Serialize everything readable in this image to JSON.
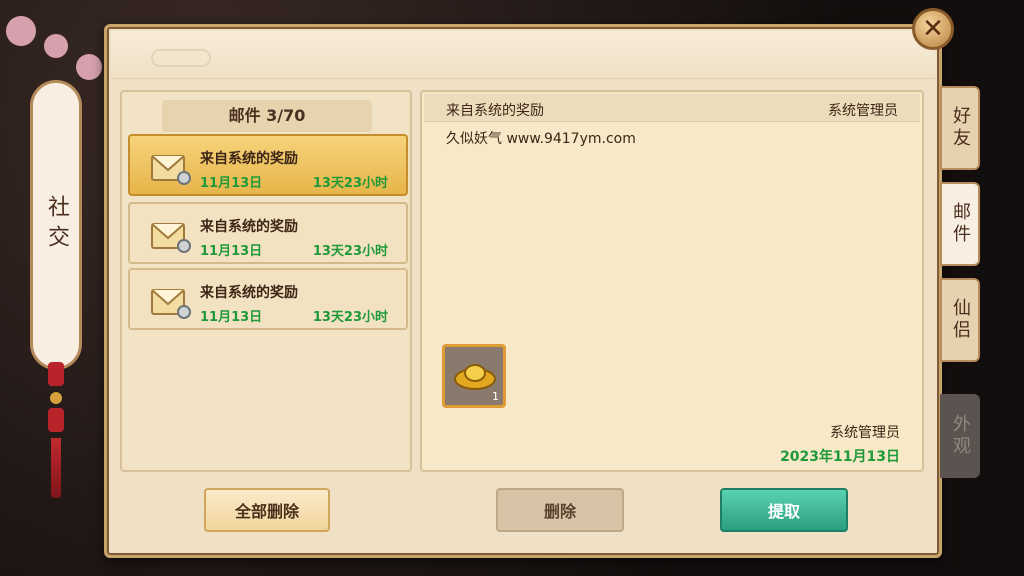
{
  "left_banner": {
    "label": "社交"
  },
  "mail_list": {
    "header": "邮件 3/70",
    "items": [
      {
        "title": "来自系统的奖励",
        "date": "11月13日",
        "expire": "13天23小时"
      },
      {
        "title": "来自系统的奖励",
        "date": "11月13日",
        "expire": "13天23小时"
      },
      {
        "title": "来自系统的奖励",
        "date": "11月13日",
        "expire": "13天23小时"
      }
    ]
  },
  "detail": {
    "subject": "来自系统的奖励",
    "sender_top": "系统管理员",
    "body": "久似妖气 www.9417ym.com",
    "attachment": {
      "icon": "gold-ingot-icon",
      "count": "1"
    },
    "sender_bottom": "系统管理员",
    "date": "2023年11月13日"
  },
  "buttons": {
    "delete_all": "全部删除",
    "delete": "删除",
    "claim": "提取"
  },
  "side_tabs": [
    {
      "label": "好友"
    },
    {
      "label": "邮件"
    },
    {
      "label": "仙侣"
    },
    {
      "label": "外观"
    }
  ],
  "close_glyph": "✕",
  "colors": {
    "accent_green": "#1f9a3a",
    "claim_button": "#2a9e80",
    "selected_item": "#e7b54a"
  }
}
